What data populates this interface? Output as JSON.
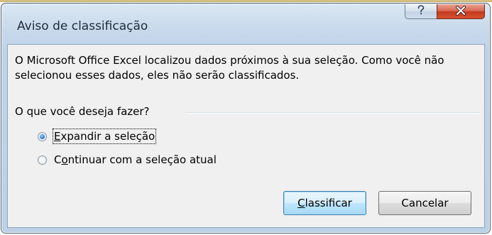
{
  "dialog": {
    "title": "Aviso de classificação",
    "help_glyph": "?",
    "close_glyph": "X"
  },
  "content": {
    "message": "O Microsoft Office Excel localizou dados próximos à sua seleção. Como você não selecionou esses dados, eles não serão classificados.",
    "question": "O que você deseja fazer?"
  },
  "options": [
    {
      "label_pre": "",
      "label_accel": "E",
      "label_post": "xpandir a seleção",
      "selected": true
    },
    {
      "label_pre": "C",
      "label_accel": "o",
      "label_post": "ntinuar com a seleção atual",
      "selected": false
    }
  ],
  "buttons": {
    "sort": {
      "accel": "C",
      "rest": "lassificar"
    },
    "cancel": "Cancelar"
  },
  "colors": {
    "frame": "#c6d8ea",
    "client": "#f0f0f0",
    "close_button": "#c4381f",
    "default_button_border": "#3c7fb1"
  },
  "icons": {
    "help": "help-icon",
    "close": "close-icon"
  }
}
